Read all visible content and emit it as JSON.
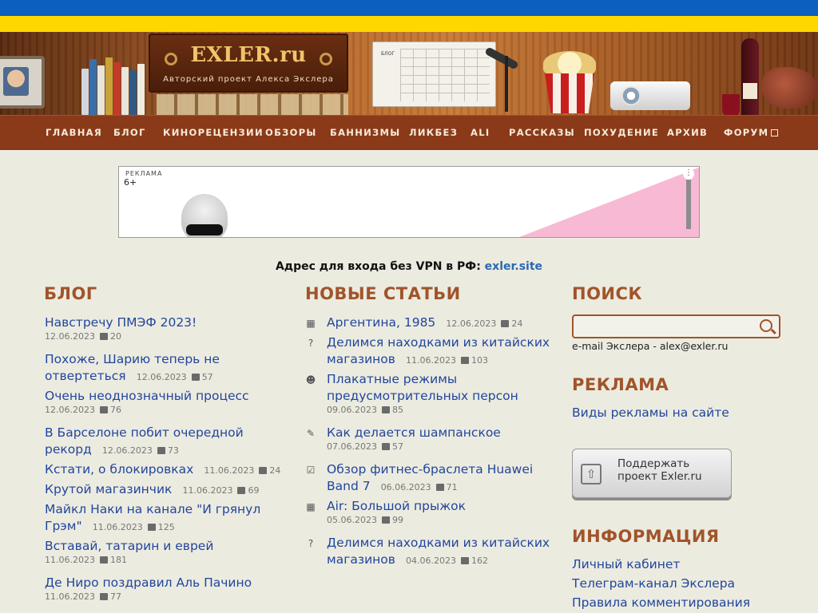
{
  "header": {
    "logo": "EXLER.ru",
    "tagline": "Авторский проект Алекса Экслера",
    "calendar_label": "БЛОГ"
  },
  "nav": [
    {
      "label": "ГЛАВНАЯ"
    },
    {
      "label": "БЛОГ"
    },
    {
      "label": "КИНОРЕЦЕНЗИИ"
    },
    {
      "label": "ОБЗОРЫ"
    },
    {
      "label": "БАННИЗМЫ"
    },
    {
      "label": "ЛИКБЕЗ"
    },
    {
      "label": "ALI"
    },
    {
      "label": "РАССКАЗЫ"
    },
    {
      "label": "ПОХУДЕНИЕ"
    },
    {
      "label": "АРХИВ"
    },
    {
      "label": "ФОРУМ"
    }
  ],
  "ad": {
    "label": "РЕКЛАМА",
    "age": "6+"
  },
  "vpn": {
    "text": "Адрес для входа без VPN в РФ: ",
    "link": "exler.site"
  },
  "blog": {
    "title": "БЛОГ",
    "items": [
      {
        "title": "Навстречу ПМЭФ 2023!",
        "date": "12.06.2023",
        "comments": "20"
      },
      {
        "title": "Похоже, Шарию теперь не",
        "title2": "отвертеться",
        "date": "12.06.2023",
        "comments": "57"
      },
      {
        "title": "Очень неоднозначный процесс",
        "date": "12.06.2023",
        "comments": "76"
      },
      {
        "title": "В Барселоне побит очередной",
        "title2": "рекорд",
        "date": "12.06.2023",
        "comments": "73"
      },
      {
        "title": "Кстати, о блокировках",
        "date": "11.06.2023",
        "comments": "24"
      },
      {
        "title": "Крутой магазинчик",
        "date": "11.06.2023",
        "comments": "69"
      },
      {
        "title": "Майкл Наки на канале \"И грянул",
        "title2": "Грэм\"",
        "date": "11.06.2023",
        "comments": "125"
      },
      {
        "title": "Вставай, татарин и еврей",
        "date": "11.06.2023",
        "comments": "181"
      },
      {
        "title": "Де Ниро поздравил Аль Пачино",
        "date": "11.06.2023",
        "comments": "77"
      }
    ]
  },
  "articles": {
    "title": "НОВЫЕ СТАТЬИ",
    "items": [
      {
        "icon": "film-icon",
        "title": "Аргентина, 1985",
        "date": "12.06.2023",
        "comments": "24"
      },
      {
        "icon": "question-icon",
        "title": "Делимся находками из китайских",
        "title2": "магазинов",
        "date": "11.06.2023",
        "comments": "103"
      },
      {
        "icon": "smile-icon",
        "title": "Плакатные режимы",
        "title2": "предусмотрительных персон",
        "date": "09.06.2023",
        "comments": "85"
      },
      {
        "icon": "pencil-icon",
        "title": "Как делается шампанское",
        "date": "07.06.2023",
        "comments": "57"
      },
      {
        "icon": "clipboard-icon",
        "title": "Обзор фитнес-браслета Huawei",
        "title2": "Band 7",
        "date": "06.06.2023",
        "comments": "71"
      },
      {
        "icon": "film-icon",
        "title": "Air: Большой прыжок",
        "date": "05.06.2023",
        "comments": "99"
      },
      {
        "icon": "question-icon",
        "title": "Делимся находками из китайских",
        "title2": "магазинов",
        "date": "04.06.2023",
        "comments": "162"
      }
    ]
  },
  "sidebar": {
    "search_title": "ПОИСК",
    "search_placeholder": "",
    "email_line": "e-mail Экслера - alex@exler.ru",
    "ads_title": "РЕКЛАМА",
    "ads_link": "Виды рекламы на сайте",
    "support_label": "Поддержать проект Exler.ru",
    "info_title": "ИНФОРМАЦИЯ",
    "info_links": [
      "Личный кабинет",
      "Телеграм-канал Экслера",
      "Правила комментирования"
    ]
  }
}
